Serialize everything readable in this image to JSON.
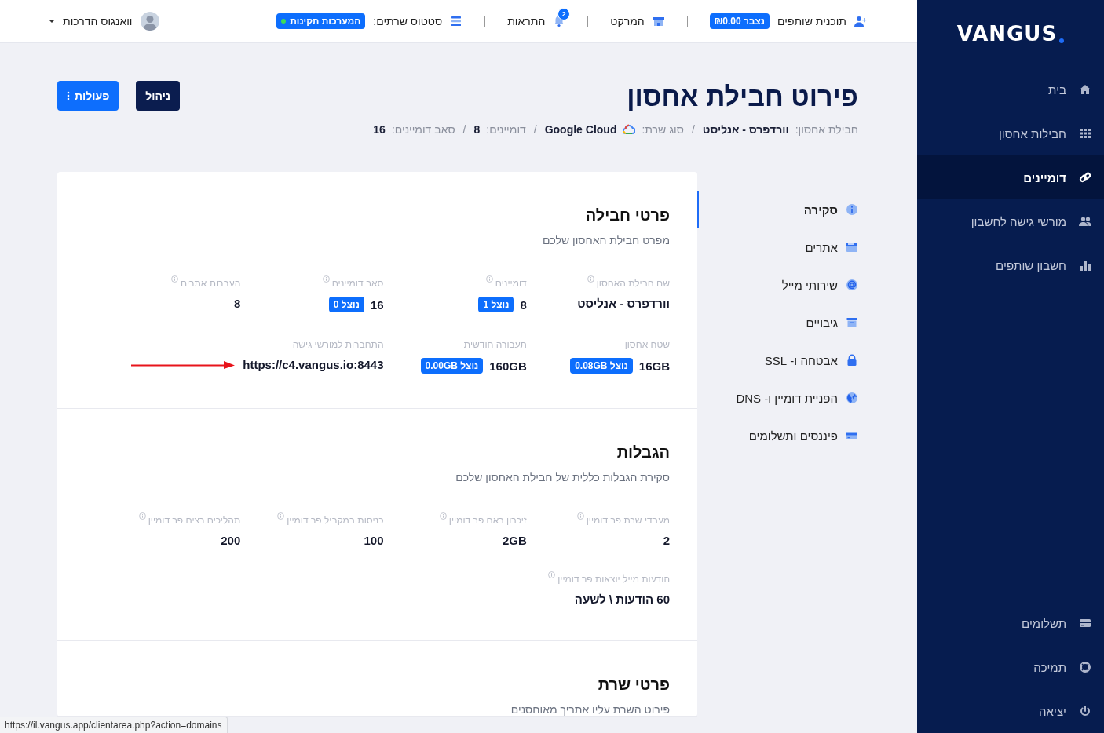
{
  "sidebar": {
    "logo": "VANGUS",
    "items": [
      {
        "label": "בית",
        "kind": "home",
        "selected": false
      },
      {
        "label": "חבילות אחסון",
        "kind": "grid",
        "selected": false
      },
      {
        "label": "דומיינים",
        "kind": "link",
        "selected": true
      },
      {
        "label": "מורשי גישה לחשבון",
        "kind": "users",
        "selected": false
      },
      {
        "label": "חשבון שותפים",
        "kind": "chart",
        "selected": false
      }
    ],
    "bottom_items": [
      {
        "label": "תשלומים",
        "kind": "card",
        "selected": false
      },
      {
        "label": "תמיכה",
        "kind": "support",
        "selected": false
      },
      {
        "label": "יציאה",
        "kind": "power",
        "selected": false
      }
    ]
  },
  "top_bar": {
    "links": [
      {
        "kind": "affiliate",
        "label": "תוכנית שותפים",
        "badge": "נצבר ₪0.00"
      },
      {
        "kind": "market",
        "label": "המרקט"
      },
      {
        "kind": "notifications",
        "label": "התראות",
        "count": "2"
      },
      {
        "kind": "status",
        "label": "סטטוס שרתים:",
        "badge": "המערכות תקינות"
      }
    ],
    "user": {
      "name": "וואנגוס הדרכות"
    }
  },
  "header": {
    "title": "פירוט חבילת אחסון",
    "meta": [
      {
        "label": "חבילת אחסון:",
        "value": "וורדפרס - אנליסט"
      },
      {
        "separator": "/",
        "label": "סוג שרת:",
        "value": "Google Cloud",
        "kind": "cloud"
      },
      {
        "separator": "/",
        "label": "דומיינים:",
        "value": "8"
      },
      {
        "separator": "/",
        "label": "סאב דומיינים:",
        "value": "16"
      }
    ],
    "buttons": [
      {
        "label": "ניהול",
        "kind": "dark"
      },
      {
        "label": "פעולות",
        "kind": "primary"
      }
    ]
  },
  "subnav": [
    {
      "label": "סקירה",
      "kind": "info",
      "selected": true
    },
    {
      "label": "אתרים",
      "kind": "browser",
      "selected": false
    },
    {
      "label": "שירותי מייל",
      "kind": "at",
      "selected": false
    },
    {
      "label": "גיבויים",
      "kind": "archive",
      "selected": false
    },
    {
      "label": "אבטחה ו- SSL",
      "kind": "lock",
      "selected": false
    },
    {
      "label": "הפניית דומיין ו- DNS",
      "kind": "globe",
      "selected": false
    },
    {
      "label": "פיננסים ותשלומים",
      "kind": "creditcard",
      "selected": false
    }
  ],
  "sections": [
    {
      "title": "פרטי חבילה",
      "subtitle": "מפרט חבילת האחסון שלכם",
      "fields": [
        {
          "label": "שם חבילת האחסון",
          "value": "וורדפרס - אנליסט",
          "info": true
        },
        {
          "label": "דומיינים",
          "value": "8",
          "badge": "נוצל 1",
          "info": true
        },
        {
          "label": "סאב דומיינים",
          "value": "16",
          "badge": "נוצל 0",
          "info": true
        },
        {
          "label": "העברות אתרים",
          "value": "8",
          "info": true
        },
        {
          "label": "שטח אחסון",
          "value": "16GB",
          "badge": "נוצל 0.08GB",
          "info": false
        },
        {
          "label": "תעבורה חודשית",
          "value": "160GB",
          "badge": "נוצל 0.00GB",
          "info": false
        },
        {
          "label": "התחברות למורשי גישה",
          "value": "https://c4.vangus.io:8443",
          "info": false,
          "arrow": true
        }
      ]
    },
    {
      "title": "הגבלות",
      "subtitle": "סקירת הגבלות כללית של חבילת האחסון שלכם",
      "fields": [
        {
          "label": "מעבדי שרת פר דומיין",
          "value": "2",
          "info": true
        },
        {
          "label": "זיכרון ראם פר דומיין",
          "value": "2GB",
          "info": true
        },
        {
          "label": "כניסות במקביל פר דומיין",
          "value": "100",
          "info": true
        },
        {
          "label": "תהליכים רצים פר דומיין",
          "value": "200",
          "info": true
        },
        {
          "label": "הודעות מייל יוצאות פר דומיין",
          "value": "60 הודעות \\ לשעה",
          "info": true
        }
      ]
    },
    {
      "title": "פרטי שרת",
      "subtitle": "פירוט השרת עליו אתריך מאוחסנים"
    }
  ],
  "status_bar": "https://il.vangus.app/clientarea.php?action=domains"
}
